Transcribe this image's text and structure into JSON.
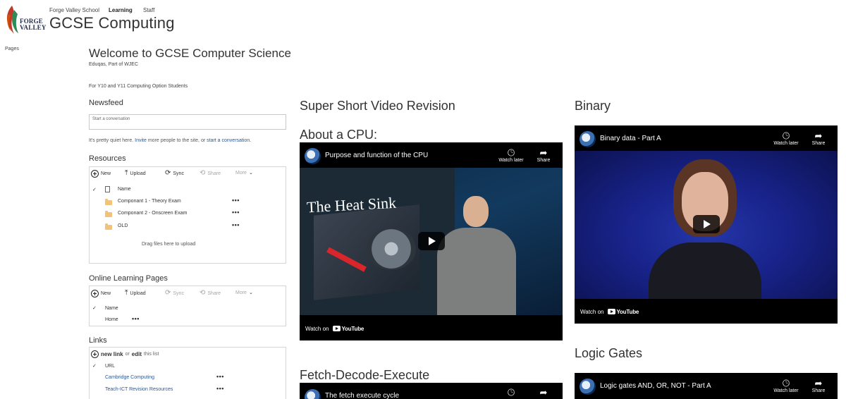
{
  "header": {
    "logo_text_line1": "FORGE",
    "logo_text_line2": "VALLEY",
    "nav": [
      "Forge Valley School",
      "Learning",
      "Staff"
    ],
    "site_title": "GCSE Computing"
  },
  "left_nav": {
    "pages_label": "Pages"
  },
  "welcome": {
    "title": "Welcome to GCSE Computer Science",
    "subtitle": "Eduqas, Part of WJEC",
    "note": "For Y10 and Y11 Computing Option Students"
  },
  "newsfeed": {
    "heading": "Newsfeed",
    "input_placeholder": "Start a conversation",
    "quiet_pre": "It's pretty quiet here.",
    "invite_link": "Invite",
    "quiet_mid": "more people to the site, or",
    "start_link": "start a conversation."
  },
  "resources": {
    "heading": "Resources",
    "commands": [
      "New",
      "Upload",
      "Sync",
      "Share",
      "More"
    ],
    "column_name": "Name",
    "items": [
      "Componant 1 - Theory Exam",
      "Componant 2 - Onscreen Exam",
      "OLD"
    ],
    "drag_text": "Drag files here to upload"
  },
  "online_learning": {
    "heading": "Online Learning Pages",
    "commands": [
      "New",
      "Upload",
      "Sync",
      "Share",
      "More"
    ],
    "column_name": "Name",
    "items": [
      "Home"
    ]
  },
  "links": {
    "heading": "Links",
    "new_link": "new link",
    "or_text": "or",
    "edit_text": "edit",
    "this_list": "this list",
    "column_url": "URL",
    "items": [
      "Cambridge Computing",
      "Teach-ICT Revision Resources"
    ]
  },
  "videos": {
    "section_heading": "Super Short Video Revision",
    "cpu_heading": "About a CPU:",
    "fde_heading": "Fetch-Decode-Execute",
    "binary_heading": "Binary",
    "logic_heading": "Logic Gates",
    "cpu_title": "Purpose and function of the CPU",
    "binary_title": "Binary data - Part A",
    "fde_title": "The fetch execute cycle",
    "logic_title": "Logic gates AND, OR, NOT - Part A",
    "cpu_overlay_text": "The Heat Sink",
    "watch_later": "Watch later",
    "share": "Share",
    "watch_on": "Watch on",
    "youtube": "YouTube"
  },
  "colors": {
    "link": "#2b5797",
    "text": "#333333",
    "border": "#d5d5d5",
    "folder": "#f2c27a"
  }
}
